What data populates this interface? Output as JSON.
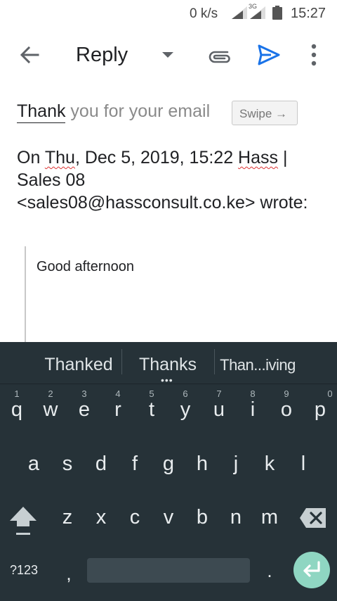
{
  "status_bar": {
    "net_speed": "0 k/s",
    "network_type": "3G",
    "time": "15:27",
    "icons": [
      "signal-icon",
      "battery-icon"
    ]
  },
  "app_bar": {
    "title": "Reply",
    "icons": [
      "back-arrow-icon",
      "dropdown-arrow-icon",
      "attachment-icon",
      "send-icon",
      "more-vert-icon"
    ],
    "accent_color": "#1a73e8"
  },
  "compose": {
    "first_word": "Thank",
    "rest_of_line": " you for your email",
    "swipe_chip": "Swipe →",
    "quote_header": {
      "on": "On ",
      "day": "Thu",
      "middle": ", Dec 5, 2019, 15:22 ",
      "sender_first": "Hass",
      "sender_rest": " | Sales 08 <sales08@hassconsult.co.ke> wrote:"
    },
    "quoted_body": "Good afternoon"
  },
  "keyboard": {
    "suggestions": [
      "Thanked",
      "Thanks",
      "Than...iving"
    ],
    "row1": [
      {
        "ch": "q",
        "hint": "1"
      },
      {
        "ch": "w",
        "hint": "2"
      },
      {
        "ch": "e",
        "hint": "3"
      },
      {
        "ch": "r",
        "hint": "4"
      },
      {
        "ch": "t",
        "hint": "5"
      },
      {
        "ch": "y",
        "hint": "6"
      },
      {
        "ch": "u",
        "hint": "7"
      },
      {
        "ch": "i",
        "hint": "8"
      },
      {
        "ch": "o",
        "hint": "9"
      },
      {
        "ch": "p",
        "hint": "0"
      }
    ],
    "row2": [
      "a",
      "s",
      "d",
      "f",
      "g",
      "h",
      "j",
      "k",
      "l"
    ],
    "row3": [
      "z",
      "x",
      "c",
      "v",
      "b",
      "n",
      "m"
    ],
    "symbols_label": "?123",
    "comma": ",",
    "period": ".",
    "background_color": "#263238",
    "enter_color": "#8fd6c2"
  }
}
